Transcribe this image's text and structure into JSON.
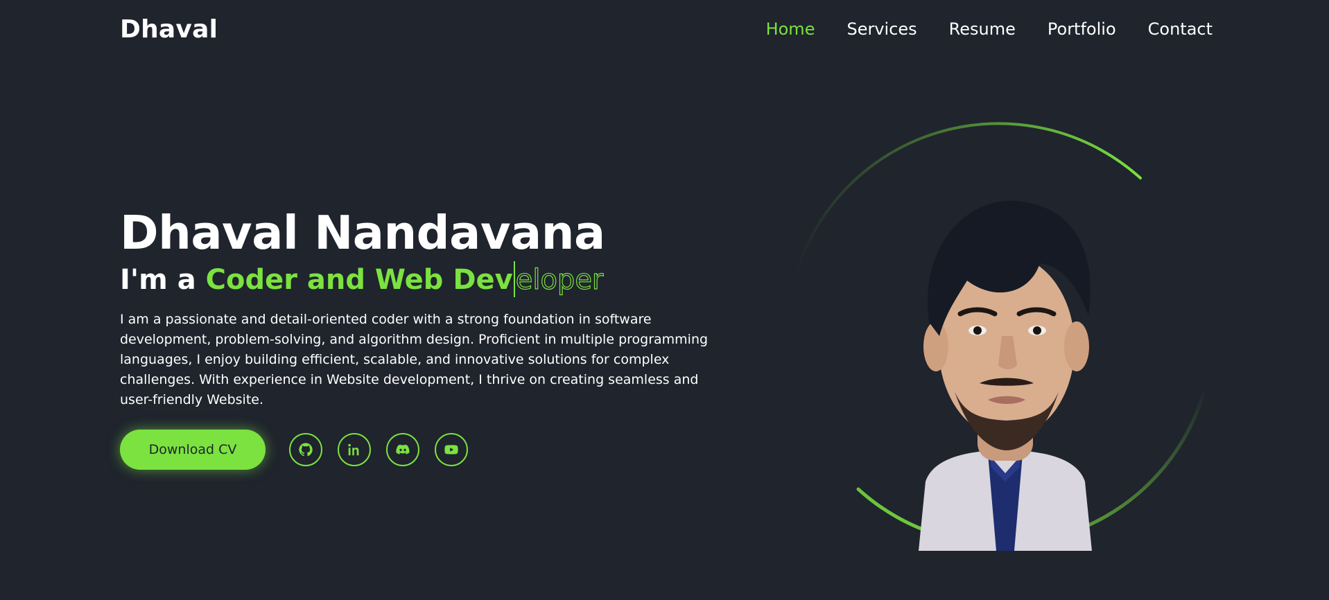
{
  "header": {
    "logo": "Dhaval",
    "nav": [
      {
        "label": "Home",
        "active": true
      },
      {
        "label": "Services",
        "active": false
      },
      {
        "label": "Resume",
        "active": false
      },
      {
        "label": "Portfolio",
        "active": false
      },
      {
        "label": "Contact",
        "active": false
      }
    ]
  },
  "hero": {
    "name": "Dhaval Nandavana",
    "role_prefix": "I'm a ",
    "role_typed": "Coder and Web Dev",
    "role_pending": "eloper",
    "description": "I am a passionate and detail-oriented coder with a strong foundation in software development, problem-solving, and algorithm design. Proficient in multiple programming languages, I enjoy building efficient, scalable, and innovative solutions for complex challenges. With experience in Website development, I thrive on creating seamless and user-friendly Website.",
    "cta_label": "Download CV",
    "socials": [
      {
        "icon": "github-icon"
      },
      {
        "icon": "linkedin-icon"
      },
      {
        "icon": "discord-icon"
      },
      {
        "icon": "youtube-icon"
      }
    ]
  },
  "colors": {
    "background": "#1f242d",
    "accent": "#7be23f",
    "text": "#ffffff"
  }
}
